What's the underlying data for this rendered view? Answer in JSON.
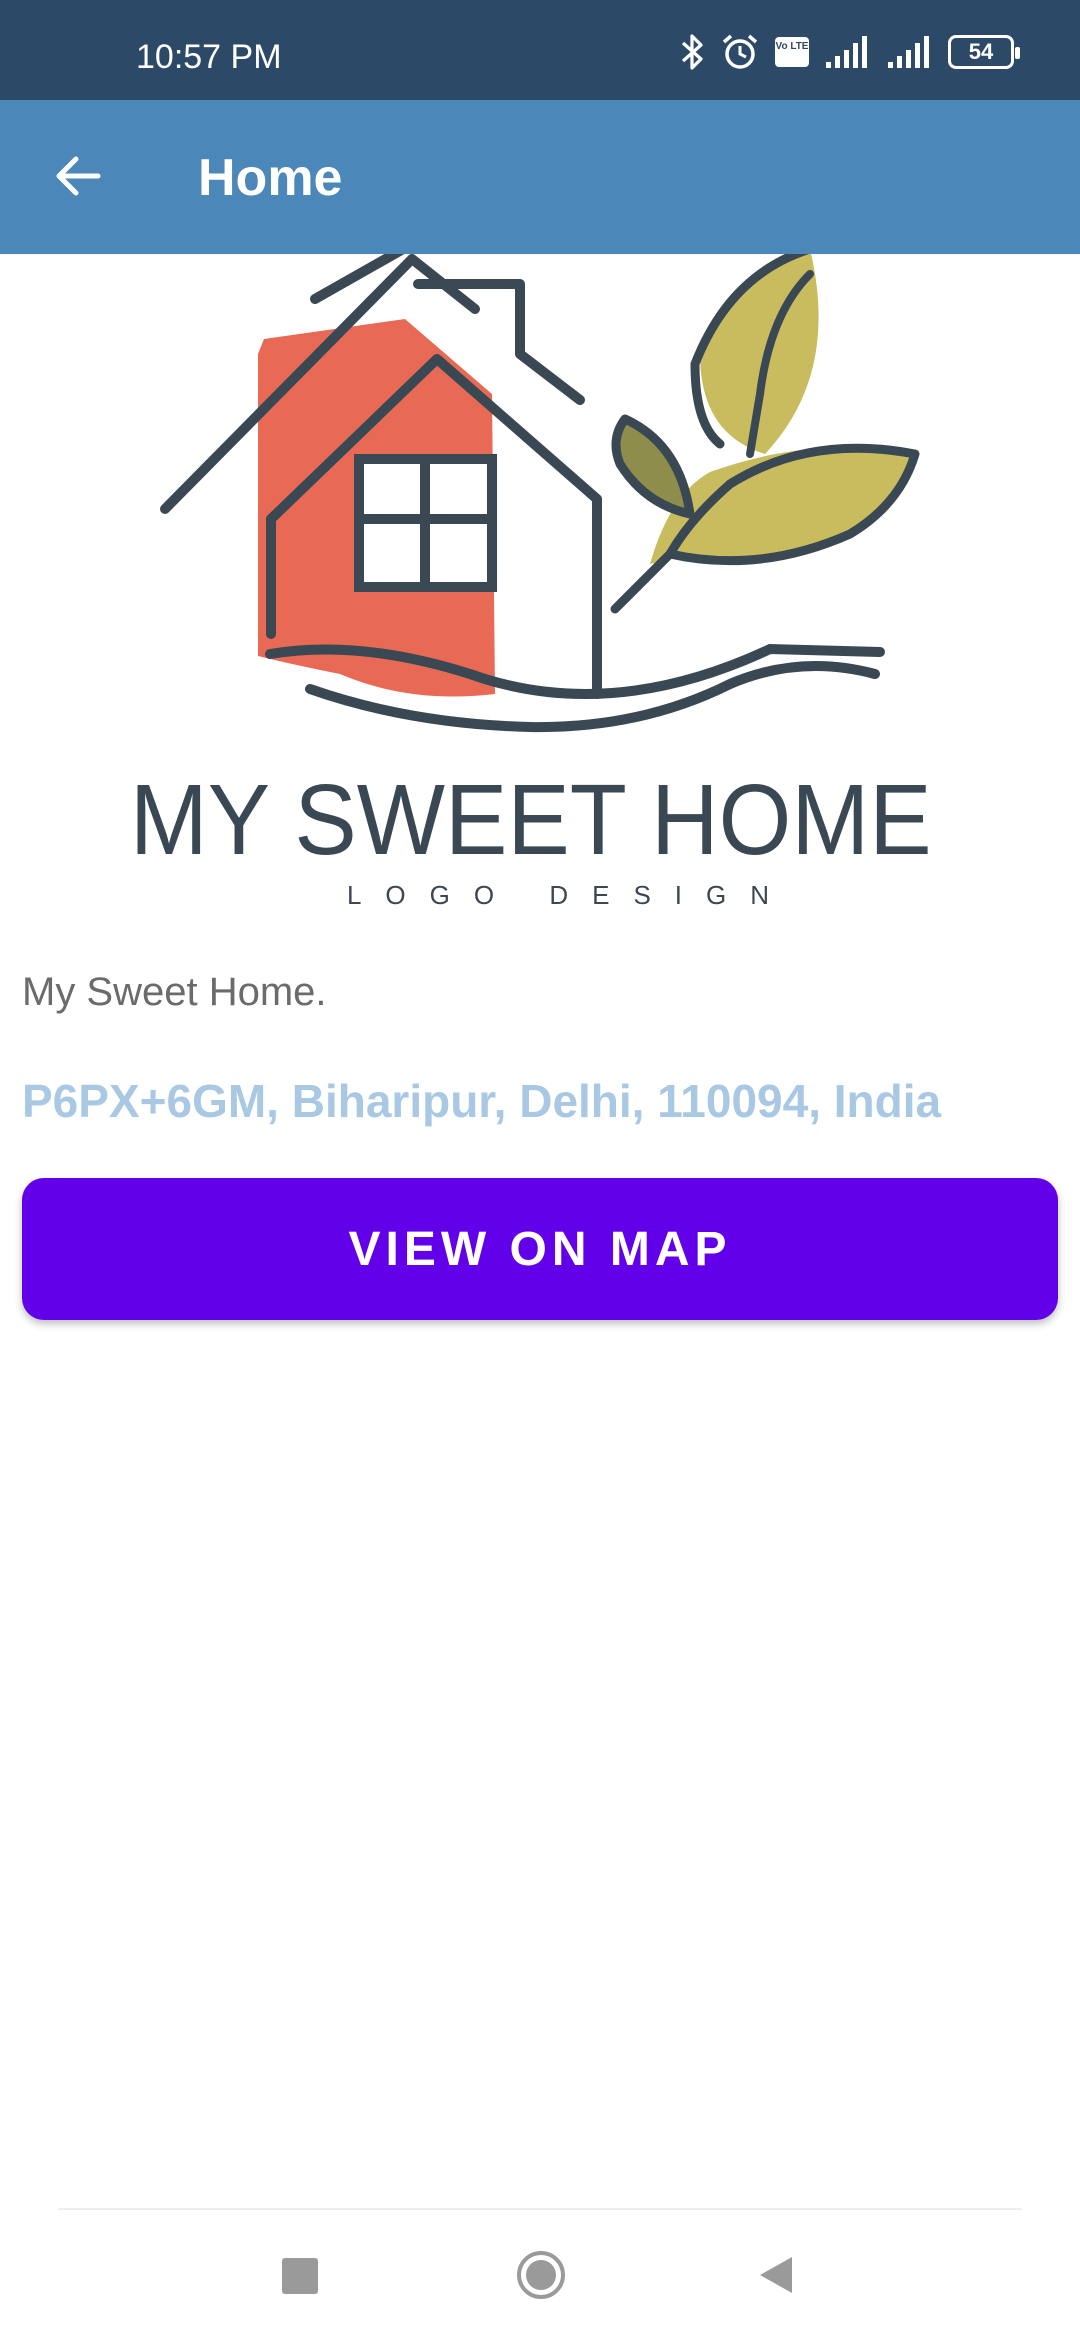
{
  "status_bar": {
    "time": "10:57 PM",
    "battery": "54",
    "volte_label": "Vo LTE",
    "icons": [
      "bluetooth-icon",
      "alarm-icon",
      "volte-icon",
      "signal-icon",
      "signal-icon",
      "battery-icon"
    ]
  },
  "app_bar": {
    "title": "Home",
    "back_icon": "arrow-left-icon",
    "color": "#4b87b8"
  },
  "logo": {
    "title": "MY SWEET HOME",
    "subtitle": "LOGO DESIGN"
  },
  "place": {
    "name": "My Sweet Home.",
    "address": "P6PX+6GM, Biharipur, Delhi, 110094, India"
  },
  "actions": {
    "view_on_map": "VIEW ON MAP",
    "button_color": "#6200ea"
  },
  "nav_bar": {
    "icons": [
      "square-icon",
      "circle-icon",
      "triangle-back-icon"
    ]
  }
}
